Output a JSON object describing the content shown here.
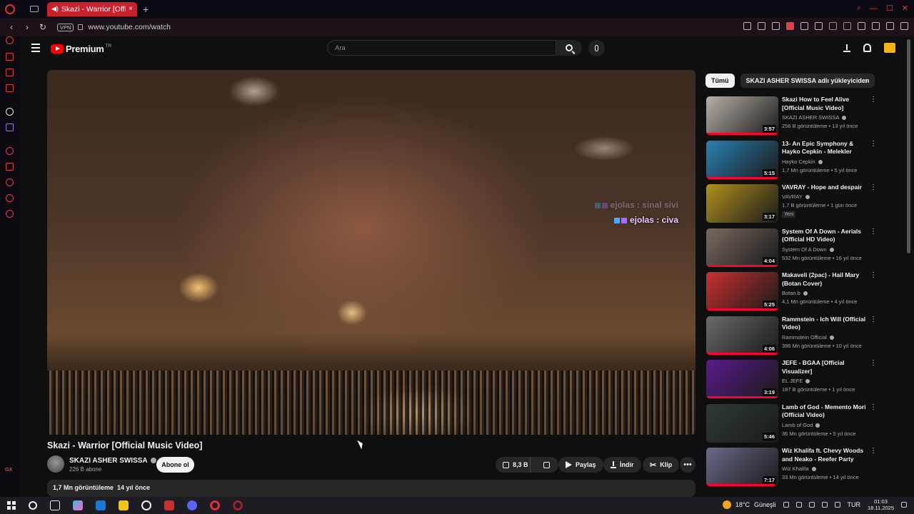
{
  "browser": {
    "tab_title": "Skazi - Warrior [Officia",
    "tab_close": "×",
    "new_tab": "+",
    "vpn_label": "VPN",
    "url": "www.youtube.com/watch"
  },
  "youtube": {
    "logo_text": "Premium",
    "country": "TR",
    "search_placeholder": "Ara"
  },
  "video": {
    "title": "Skazi - Warrior [Official Music Video]",
    "channel_name": "SKAZI ASHER SWISSA",
    "subscribers": "226 B abone",
    "subscribe_label": "Abone ol",
    "likes": "8,3 B",
    "share_label": "Paylaş",
    "download_label": "İndir",
    "clip_label": "Klip",
    "more": "•••",
    "views": "1,7 Mn görüntüleme",
    "age": "14 yıl önce",
    "overlay_chat": [
      {
        "user": "ejolas",
        "text": "sinal sivi",
        "faded": true
      },
      {
        "user": "ejolas",
        "text": "civa",
        "faded": false
      }
    ]
  },
  "chips": {
    "all": "Tümü",
    "uploader": "SKAZI ASHER SWISSA adlı yükleyiciden",
    "next": "›"
  },
  "recommendations": [
    {
      "title": "Skazi How to Feel Alive [Official Music Video]",
      "channel": "SKAZI ASHER SWISSA",
      "meta": "256 B görüntüleme • 13 yıl önce",
      "duration": "3:57",
      "progress": 1.0,
      "thumb_color": "#b8b0a8"
    },
    {
      "title": "13- An Epic Symphony & Hayko Cepkin - Melekler",
      "channel": "Hayko Cepkin",
      "meta": "1,7 Mn görüntüleme • 5 yıl önce",
      "duration": "5:15",
      "progress": 1.0,
      "thumb_color": "#2a7fb0"
    },
    {
      "title": "VAVRAY - Hope and despair",
      "channel": "VAVRAY",
      "meta": "1,7 B görüntüleme • 1 gün önce",
      "duration": "3:17",
      "tag": "Yeni",
      "progress": 0,
      "thumb_color": "#b0901e"
    },
    {
      "title": "System Of A Down - Aerials (Official HD Video)",
      "channel": "System Of A Down",
      "meta": "532 Mn görüntüleme • 16 yıl önce",
      "duration": "4:04",
      "progress": 1.0,
      "thumb_color": "#7a6a60"
    },
    {
      "title": "Makaveli (2pac) - Hail Mary (Botan Cover)",
      "channel": "Botan.b",
      "meta": "4,1 Mn görüntüleme • 4 yıl önce",
      "duration": "5:25",
      "progress": 1.0,
      "thumb_color": "#c83030"
    },
    {
      "title": "Rammstein - Ich Will (Official Video)",
      "channel": "Rammstein Official",
      "meta": "396 Mn görüntüleme • 10 yıl önce",
      "duration": "4:06",
      "progress": 1.0,
      "thumb_color": "#6a6a6a"
    },
    {
      "title": "JEFE - BGAA [Official Visualizer]",
      "channel": "EL JEFE",
      "meta": "187 B görüntüleme • 1 yıl önce",
      "duration": "3:19",
      "progress": 1.0,
      "thumb_color": "#5a1a8a"
    },
    {
      "title": "Lamb of God - Memento Mori (Official Video)",
      "channel": "Lamb of God",
      "meta": "36 Mn görüntüleme • 5 yıl önce",
      "duration": "5:46",
      "progress": 0,
      "thumb_color": "#2e3a38"
    },
    {
      "title": "Wiz Khalifa ft. Chevy Woods and Neako - Reefer Party",
      "channel": "Wiz Khalifa",
      "meta": "33 Mn görüntüleme • 14 yıl önce",
      "duration": "7:17",
      "progress": 0.95,
      "thumb_color": "#6a6a8a"
    }
  ],
  "taskbar": {
    "temperature": "18°C",
    "weather": "Güneşli",
    "language": "TUR",
    "time": "01:03",
    "date": "18.11.2025"
  },
  "colors": {
    "accent": "#ff0033",
    "opera_red": "#e0303a"
  }
}
